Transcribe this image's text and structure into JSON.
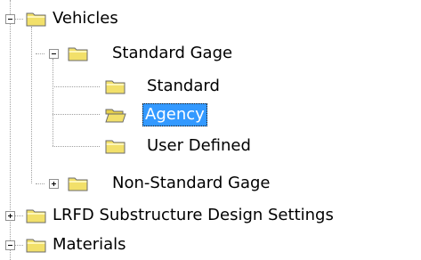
{
  "tree": {
    "vehicles": {
      "label": "Vehicles",
      "expanded": true
    },
    "standard_gage": {
      "label": "Standard Gage",
      "expanded": true
    },
    "standard": {
      "label": "Standard"
    },
    "agency": {
      "label": "Agency",
      "selected": true
    },
    "user_defined": {
      "label": "User Defined"
    },
    "non_standard_gage": {
      "label": "Non-Standard Gage",
      "expanded": false
    },
    "lrfd_substructure": {
      "label": "LRFD Substructure Design Settings",
      "expanded": false
    },
    "materials": {
      "label": "Materials",
      "expanded": true
    }
  },
  "colors": {
    "selection_bg": "#3399ff",
    "folder_yellow": "#f2e06a"
  }
}
